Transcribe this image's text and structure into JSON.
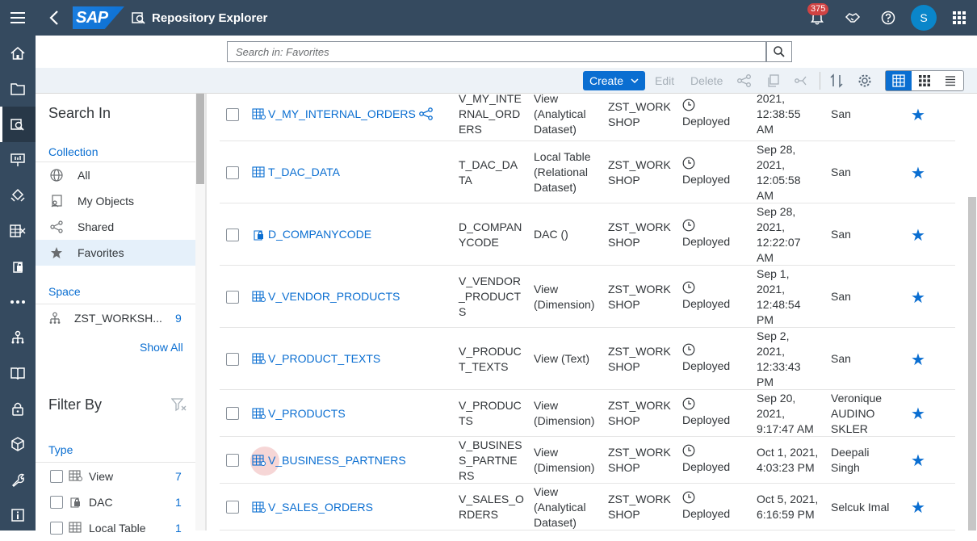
{
  "shell": {
    "logo_text": "SAP",
    "title": "Repository Explorer",
    "notification_count": "375",
    "avatar_initial": "S"
  },
  "search": {
    "placeholder": "Search in: Favorites"
  },
  "toolbar": {
    "create_label": "Create",
    "edit_label": "Edit",
    "delete_label": "Delete"
  },
  "left_panel": {
    "search_in_title": "Search In",
    "collection_label": "Collection",
    "collection_items": [
      {
        "label": "All",
        "icon": "globe-icon"
      },
      {
        "label": "My Objects",
        "icon": "my-objects-icon"
      },
      {
        "label": "Shared",
        "icon": "share-icon"
      },
      {
        "label": "Favorites",
        "icon": "star-icon"
      }
    ],
    "space_label": "Space",
    "space_item": {
      "label": "ZST_WORKSH...",
      "count": "9"
    },
    "show_all": "Show All",
    "filter_title": "Filter By",
    "type_label": "Type",
    "type_items": [
      {
        "label": "View",
        "count": "7"
      },
      {
        "label": "DAC",
        "count": "1"
      },
      {
        "label": "Local Table",
        "count": "1"
      }
    ]
  },
  "rows": [
    {
      "name": "V_MY_INTERNAL_ORDERS",
      "tech": "V_MY_INTE\nRNAL_ORD\nERS",
      "type": "View\n(Analytical\nDataset)",
      "space": "ZST_WORK\nSHOP",
      "status": "Deployed",
      "date": "2021,\n12:38:55\nAM",
      "owner": "San",
      "shared": true,
      "icon": "view-icon"
    },
    {
      "name": "T_DAC_DATA",
      "tech": "T_DAC_DA\nTA",
      "type": "Local Table\n(Relational\nDataset)",
      "space": "ZST_WORK\nSHOP",
      "status": "Deployed",
      "date": "Sep 28,\n2021,\n12:05:58\nAM",
      "owner": "San",
      "icon": "table-icon"
    },
    {
      "name": "D_COMPANYCODE",
      "tech": "D_COMPAN\nYCODE",
      "type": "DAC ()",
      "space": "ZST_WORK\nSHOP",
      "status": "Deployed",
      "date": "Sep 28,\n2021,\n12:22:07\nAM",
      "owner": "San",
      "icon": "dac-icon"
    },
    {
      "name": "V_VENDOR_PRODUCTS",
      "tech": "V_VENDOR\n_PRODUCT\nS",
      "type": "View\n(Dimension)",
      "space": "ZST_WORK\nSHOP",
      "status": "Deployed",
      "date": "Sep 1,\n2021,\n12:48:54\nPM",
      "owner": "San",
      "icon": "view-icon"
    },
    {
      "name": "V_PRODUCT_TEXTS",
      "tech": "V_PRODUC\nT_TEXTS",
      "type": "View (Text)",
      "space": "ZST_WORK\nSHOP",
      "status": "Deployed",
      "date": "Sep 2,\n2021,\n12:33:43\nPM",
      "owner": "San",
      "icon": "view-icon"
    },
    {
      "name": "V_PRODUCTS",
      "tech": "V_PRODUC\nTS",
      "type": "View\n(Dimension)",
      "space": "ZST_WORK\nSHOP",
      "status": "Deployed",
      "date": "Sep 20,\n2021,\n9:17:47 AM",
      "owner": "Veronique\nAUDINO\nSKLER",
      "icon": "view-icon"
    },
    {
      "name": "V_BUSINESS_PARTNERS",
      "tech": "V_BUSINES\nS_PARTNE\nRS",
      "type": "View\n(Dimension)",
      "space": "ZST_WORK\nSHOP",
      "status": "Deployed",
      "date": "Oct 1, 2021,\n4:03:23 PM",
      "owner": "Deepali\nSingh",
      "icon": "view-icon"
    },
    {
      "name": "V_SALES_ORDERS",
      "tech": "V_SALES_O\nRDERS",
      "type": "View\n(Analytical\nDataset)",
      "space": "ZST_WORK\nSHOP",
      "status": "Deployed",
      "date": "Oct 5, 2021,\n6:16:59 PM",
      "owner": "Selcuk Imal",
      "icon": "view-icon"
    }
  ]
}
